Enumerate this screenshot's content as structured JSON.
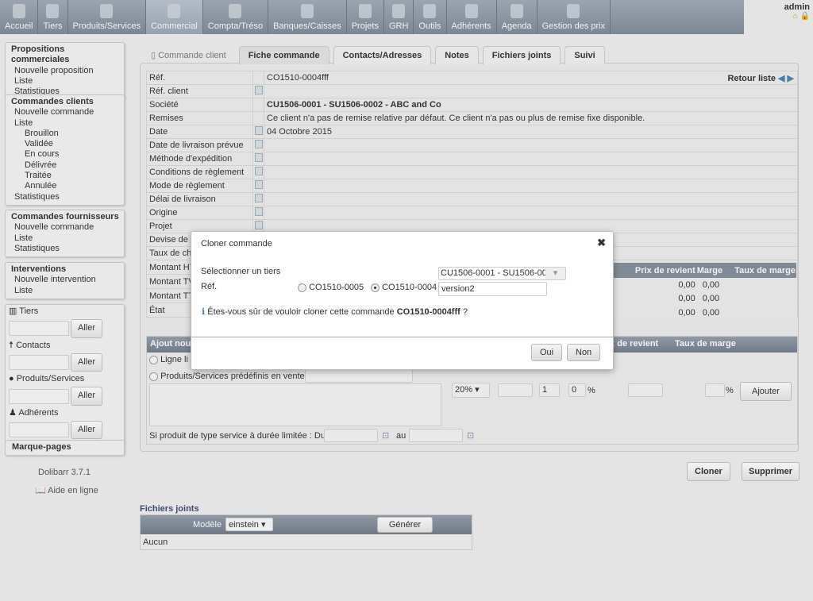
{
  "nav": [
    "Accueil",
    "Tiers",
    "Produits/Services",
    "Commercial",
    "Compta/Tréso",
    "Banques/Caisses",
    "Projets",
    "GRH",
    "Outils",
    "Adhérents",
    "Agenda",
    "Gestion des prix"
  ],
  "active_nav": "Commercial",
  "user": "admin",
  "sidebar": {
    "propositions": {
      "title": "Propositions commerciales",
      "items": [
        "Nouvelle proposition",
        "Liste",
        "Statistiques"
      ]
    },
    "commandes": {
      "title": "Commandes clients",
      "items": [
        "Nouvelle commande",
        "Liste"
      ],
      "sub": [
        "Brouillon",
        "Validée",
        "En cours",
        "Délivrée",
        "Traitée",
        "Annulée"
      ],
      "last": "Statistiques"
    },
    "fournisseurs": {
      "title": "Commandes fournisseurs",
      "items": [
        "Nouvelle commande",
        "Liste",
        "Statistiques"
      ]
    },
    "interventions": {
      "title": "Interventions",
      "items": [
        "Nouvelle intervention",
        "Liste"
      ]
    },
    "search": {
      "tiers": "Tiers",
      "contacts": "Contacts",
      "produits": "Produits/Services",
      "adherents": "Adhérents",
      "go": "Aller"
    },
    "bookmarks": "Marque-pages",
    "version": "Dolibarr 3.7.1",
    "help": "Aide en ligne"
  },
  "tabs": {
    "head": "Commande client",
    "items": [
      "Fiche commande",
      "Contacts/Adresses",
      "Notes",
      "Fichiers joints",
      "Suivi"
    ]
  },
  "fiche": {
    "retour": "Retour liste",
    "rows": [
      {
        "l": "Réf.",
        "v": "CO1510-0004fff",
        "e": false
      },
      {
        "l": "Réf. client",
        "v": "",
        "e": true
      },
      {
        "l": "Société",
        "v": "CU1506-0001 - SU1506-0002 - ABC and Co",
        "e": false,
        "b": true
      },
      {
        "l": "Remises",
        "v": "Ce client n'a pas de remise relative par défaut. Ce client n'a pas ou plus de remise fixe disponible.",
        "e": false
      },
      {
        "l": "Date",
        "v": "04 Octobre 2015",
        "e": true
      },
      {
        "l": "Date de livraison prévue",
        "v": "",
        "e": true
      },
      {
        "l": "Méthode d'expédition",
        "v": "",
        "e": true
      },
      {
        "l": "Conditions de règlement",
        "v": "",
        "e": true
      },
      {
        "l": "Mode de règlement",
        "v": "",
        "e": true
      },
      {
        "l": "Délai de livraison",
        "v": "",
        "e": true
      },
      {
        "l": "Origine",
        "v": "",
        "e": true
      },
      {
        "l": "Projet",
        "v": "",
        "e": true
      },
      {
        "l": "Devise de",
        "v": "",
        "e": false
      },
      {
        "l": "Taux de ch",
        "v": "",
        "e": false
      },
      {
        "l": "Montant HT",
        "v": "",
        "e": false
      },
      {
        "l": "Montant TV",
        "v": "",
        "e": false
      },
      {
        "l": "Montant TT",
        "v": "",
        "e": false
      },
      {
        "l": "État",
        "v": "",
        "e": false
      }
    ],
    "margin_head": [
      "Prix de revient",
      "Marge",
      "Taux de marge"
    ],
    "margin_rows": [
      [
        "0,00",
        "0,00"
      ],
      [
        "0,00",
        "0,00"
      ],
      [
        "0,00",
        "0,00"
      ]
    ]
  },
  "add": {
    "head": "Ajout nouv",
    "head_right": [
      "ix de revient",
      "Taux de marge"
    ],
    "ligne": "Ligne li",
    "predef": "Produits/Services prédéfinis en vente",
    "tva": "20%",
    "qty": "1",
    "remise": "0",
    "pct": "%",
    "ajouter": "Ajouter",
    "service": "Si produit de type service à durée limitée : Du",
    "au": "au"
  },
  "actions": {
    "cloner": "Cloner",
    "supprimer": "Supprimer"
  },
  "files": {
    "title": "Fichiers joints",
    "modele_label": "Modèle",
    "modele": "einstein",
    "generer": "Générer",
    "aucun": "Aucun"
  },
  "dialog": {
    "title": "Cloner commande",
    "select_label": "Sélectionner un tiers",
    "select_value": "CU1506-0001 - SU1506-00",
    "ref_label": "Réf.",
    "opt1": "CO1510-0005",
    "opt2": "CO1510-0004",
    "ref_value": "version2",
    "question": "Êtes-vous sûr de vouloir cloner cette commande",
    "ref_bold": "CO1510-0004fff",
    "qmark": "?",
    "oui": "Oui",
    "non": "Non"
  }
}
